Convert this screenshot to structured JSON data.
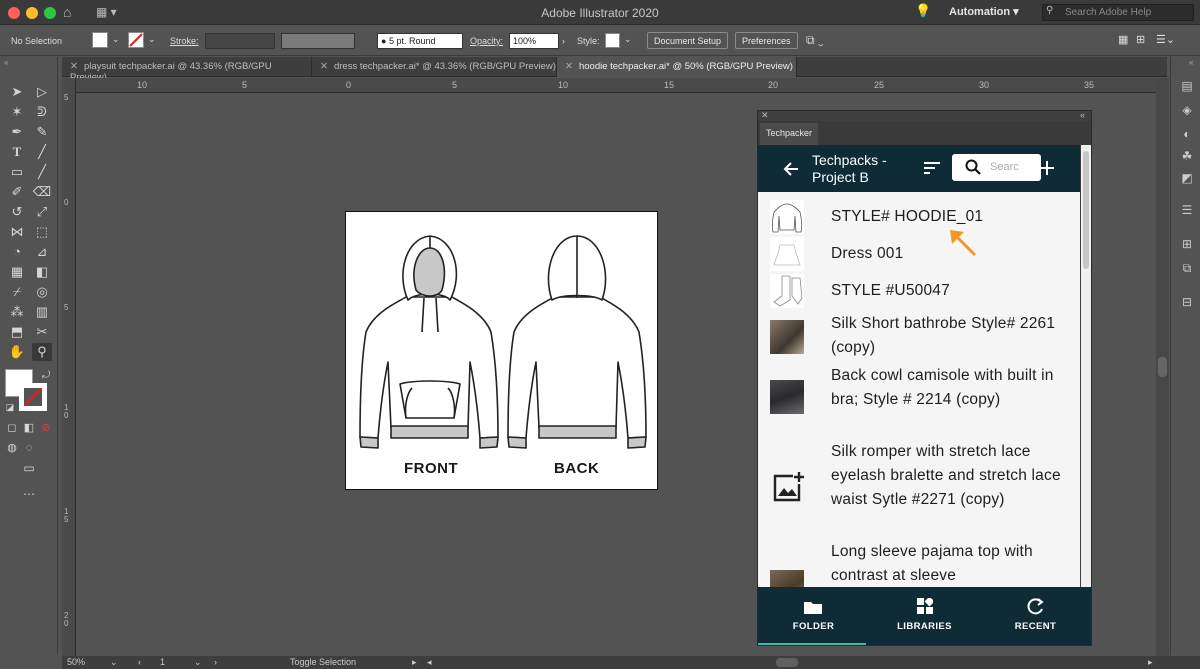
{
  "app": {
    "title": "Adobe Illustrator 2020",
    "workspace": "Automation",
    "help_placeholder": "Search Adobe Help"
  },
  "control_bar": {
    "selection": "No Selection",
    "stroke_label": "Stroke:",
    "brush": "5 pt. Round",
    "opacity_label": "Opacity:",
    "opacity_value": "100%",
    "style_label": "Style:",
    "document_setup": "Document Setup",
    "preferences": "Preferences"
  },
  "tabs": [
    {
      "label": "playsuit techpacker.ai @ 43.36% (RGB/GPU Preview)",
      "active": false
    },
    {
      "label": "dress techpacker.ai* @ 43.36% (RGB/GPU Preview)",
      "active": false
    },
    {
      "label": "hoodie techpacker.ai* @ 50% (RGB/GPU Preview)",
      "active": true
    }
  ],
  "ruler": {
    "h_labels": [
      "10",
      "5",
      "0",
      "5",
      "10",
      "15",
      "20",
      "25",
      "30",
      "35"
    ],
    "v_labels": [
      "5",
      "0",
      "5",
      "1 0",
      "1 5",
      "2 0"
    ]
  },
  "artboard": {
    "front_label": "FRONT",
    "back_label": "BACK"
  },
  "panel": {
    "tab": "Techpacker",
    "title": "Techpacks - Project B",
    "search_placeholder": "Searc",
    "items": [
      {
        "name": "STYLE# HOODIE_01",
        "thumb": "hoodie-sketch"
      },
      {
        "name": "Dress 001",
        "thumb": "dress-sketch"
      },
      {
        "name": "STYLE #U50047",
        "thumb": "socks-sketch"
      },
      {
        "name": "Silk Short bathrobe Style# 2261 (copy)",
        "thumb": "photo"
      },
      {
        "name": "Back cowl camisole with built in bra; Style # 2214 (copy)",
        "thumb": "photo"
      },
      {
        "name": "Silk romper with stretch lace eyelash bralette and stretch lace waist Sytle #2271 (copy)",
        "thumb": "add-image-icon"
      },
      {
        "name": "Long sleeve pajama top with contrast at sleeve",
        "thumb": "photo"
      }
    ],
    "nav": [
      {
        "label": "FOLDER",
        "icon": "folder-icon",
        "active": true
      },
      {
        "label": "LIBRARIES",
        "icon": "libraries-icon",
        "active": false
      },
      {
        "label": "RECENT",
        "icon": "recent-icon",
        "active": false
      }
    ],
    "accent": "#3fb8a8",
    "header_color": "#0f2b36"
  },
  "status": {
    "zoom": "50%",
    "artboard": "1",
    "tool": "Toggle Selection"
  }
}
